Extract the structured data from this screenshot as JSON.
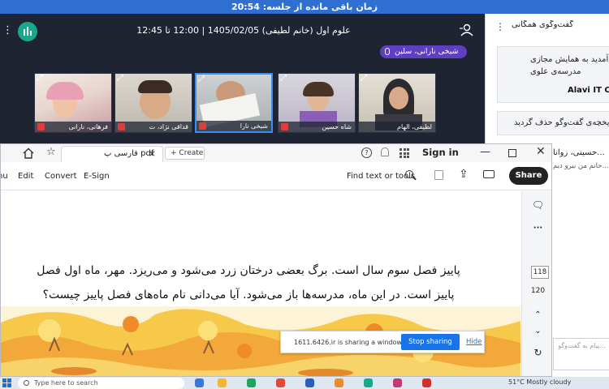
{
  "timer_bar": {
    "text": "زمان باقی مانده از جلسه: 20:54"
  },
  "meeting": {
    "title": "علوم اول (خانم لطیفی) 1405/02/05 | 12:00 تا 12:45",
    "active_speaker": "شیخی نارانی، سلین",
    "participants": [
      {
        "name": "فرهانی، نارانی",
        "muted": true
      },
      {
        "name": "قداقی نژاد، ت",
        "muted": true
      },
      {
        "name": "شیخی نارا",
        "muted": true,
        "active": true
      },
      {
        "name": "شاه حسین",
        "muted": true
      },
      {
        "name": "لطیفی، الهام",
        "muted": false
      }
    ]
  },
  "chat": {
    "title": "گفت‌وگوی همگانی",
    "card1_line1": "...خوش‌آمدید به همایش مجازی",
    "card1_line2": "مدرسه‌ی علوی",
    "card1_line3": "Alavi IT Co",
    "card2_text": "تاریخچه‌ی گفت‌وگو حذف گردید",
    "sender": "...حسینی، زوانا",
    "message": "...خانم من نیرو دیم",
    "input_placeholder": "...پیام به گفت‌وگو"
  },
  "reader": {
    "tab_label": "فارسی پ pdf",
    "create_label": "Create",
    "help_glyph": "?",
    "sign_in": "Sign in",
    "menu": [
      "nu",
      "Edit",
      "Convert",
      "E-Sign"
    ],
    "find_label": "Find text or tools",
    "share_label": "Share",
    "story_line1": "پاییز فصل سوم سال است. برگ بعضی درختان زرد می‌شود و می‌ریزد. مهر، ماه اول فصل",
    "story_line2": "پاییز است. در این ماه، مدرسه‌ها باز می‌شود. آیا می‌دانی نام ماه‌های فصل پاییز چیست؟",
    "page_current": "118",
    "page_total": "120",
    "rail_more": "···"
  },
  "share_banner": {
    "message": "1611.6426.ir is sharing a window.",
    "stop_label": "Stop sharing",
    "hide_label": "Hide"
  },
  "taskbar": {
    "search_placeholder": "Type here to search",
    "weather": "51°C  Mostly cloudy"
  },
  "colors": {
    "timer_bar": "#2e6fd1",
    "meeting_bg": "#1e2431",
    "speaker_chip": "#5e3fbf",
    "app_logo": "#1aa88d",
    "stop_sharing": "#1a73e8",
    "mute_badge": "#e23b3b"
  },
  "icons": [
    "menu-dots-icon",
    "app-logo-icon",
    "user-icon",
    "mic-icon",
    "expand-icon",
    "home-icon",
    "star-icon",
    "help-icon",
    "bell-icon",
    "apps-icon",
    "find-icon",
    "save-icon",
    "upload-icon",
    "print-icon",
    "comment-icon",
    "chevron-up-icon",
    "chevron-down-icon",
    "refresh-icon",
    "windows-start-icon",
    "search-icon"
  ]
}
